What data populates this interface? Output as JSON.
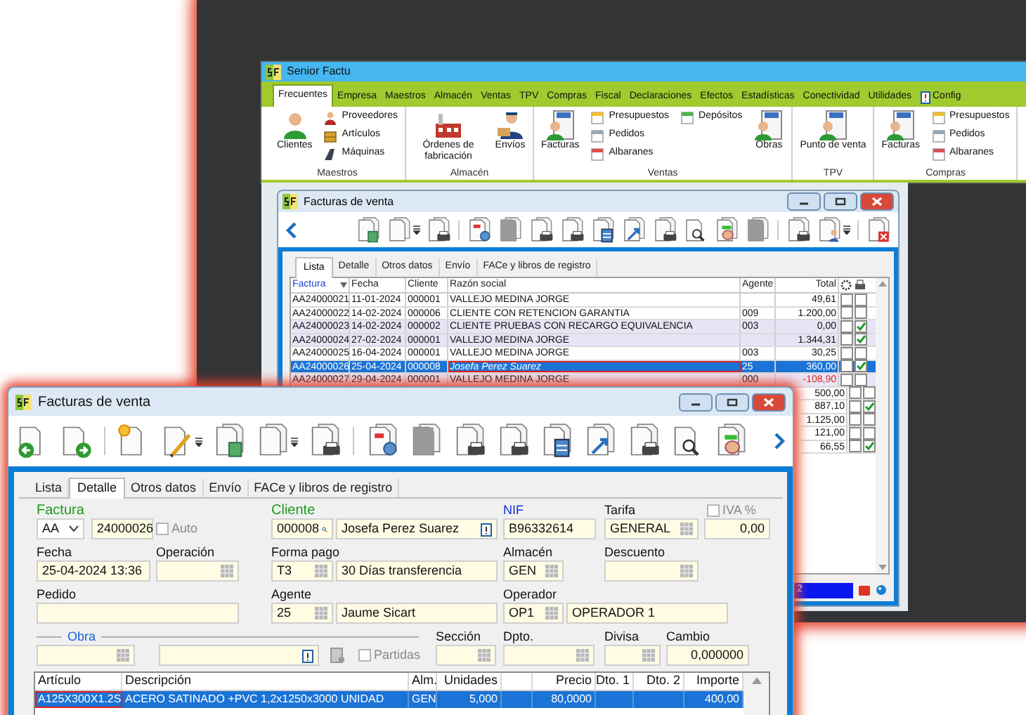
{
  "app": {
    "title": "Senior Factu",
    "tabs": [
      {
        "label": "Frecuentes",
        "selected": true
      },
      {
        "label": "Empresa",
        "selected": false
      },
      {
        "label": "Maestros",
        "selected": false
      },
      {
        "label": "Almacén",
        "selected": false
      },
      {
        "label": "Ventas",
        "selected": false
      },
      {
        "label": "TPV",
        "selected": false
      },
      {
        "label": "Compras",
        "selected": false
      },
      {
        "label": "Fiscal",
        "selected": false
      },
      {
        "label": "Declaraciones",
        "selected": false
      },
      {
        "label": "Efectos",
        "selected": false
      },
      {
        "label": "Estadísticas",
        "selected": false
      },
      {
        "label": "Conectividad",
        "selected": false
      },
      {
        "label": "Utilidades",
        "selected": false
      },
      {
        "label": "Config",
        "selected": false
      }
    ],
    "groups": [
      {
        "label": "Maestros",
        "items": [
          {
            "kind": "large",
            "label": "Clientes"
          },
          {
            "kind": "small",
            "label": "Proveedores"
          },
          {
            "kind": "small",
            "label": "Artículos"
          },
          {
            "kind": "small",
            "label": "Máquinas"
          }
        ]
      },
      {
        "label": "Almacén",
        "items": [
          {
            "kind": "large",
            "label": "Órdenes de fabricación"
          },
          {
            "kind": "large",
            "label": "Envíos"
          }
        ]
      },
      {
        "label": "Ventas",
        "items": [
          {
            "kind": "large",
            "label": "Facturas"
          },
          {
            "kind": "small",
            "label": "Presupuestos"
          },
          {
            "kind": "small",
            "label": "Pedidos"
          },
          {
            "kind": "small",
            "label": "Albaranes"
          },
          {
            "kind": "small",
            "label": "Depósitos"
          },
          {
            "kind": "large",
            "label": "Obras"
          }
        ]
      },
      {
        "label": "TPV",
        "items": [
          {
            "kind": "large",
            "label": "Punto de venta"
          }
        ]
      },
      {
        "label": "Compras",
        "items": [
          {
            "kind": "large",
            "label": "Facturas"
          },
          {
            "kind": "small",
            "label": "Presupuestos"
          },
          {
            "kind": "small",
            "label": "Pedidos"
          },
          {
            "kind": "small",
            "label": "Albaranes"
          }
        ]
      }
    ]
  },
  "list_window": {
    "title": "Facturas de venta",
    "tabs": [
      {
        "label": "Lista",
        "selected": true
      },
      {
        "label": "Detalle",
        "selected": false
      },
      {
        "label": "Otros datos",
        "selected": false
      },
      {
        "label": "Envío",
        "selected": false
      },
      {
        "label": "FACe y libros de registro",
        "selected": false
      }
    ],
    "columns": [
      "Factura",
      "Fecha",
      "Cliente",
      "Razón social",
      "Agente",
      "Total"
    ],
    "rows": [
      {
        "factura": "AA24000021",
        "fecha": "11-01-2024",
        "cliente": "000001",
        "razon_social": "VALLEJO MEDINA JORGE",
        "agente": "",
        "total": "49,61",
        "negative": false,
        "shaded": false,
        "selected": false,
        "check_1": false,
        "check_2": false
      },
      {
        "factura": "AA24000022",
        "fecha": "14-02-2024",
        "cliente": "000006",
        "razon_social": "CLIENTE CON RETENCION GARANTIA",
        "agente": "009",
        "total": "1.200,00",
        "negative": false,
        "shaded": false,
        "selected": false,
        "check_1": false,
        "check_2": false
      },
      {
        "factura": "AA24000023",
        "fecha": "14-02-2024",
        "cliente": "000002",
        "razon_social": "CLIENTE PRUEBAS CON RECARGO EQUIVALENCIA",
        "agente": "003",
        "total": "0,00",
        "negative": false,
        "shaded": true,
        "selected": false,
        "check_1": false,
        "check_2": true
      },
      {
        "factura": "AA24000024",
        "fecha": "27-02-2024",
        "cliente": "000001",
        "razon_social": "VALLEJO MEDINA JORGE",
        "agente": "",
        "total": "1.344,31",
        "negative": false,
        "shaded": true,
        "selected": false,
        "check_1": false,
        "check_2": true
      },
      {
        "factura": "AA24000025",
        "fecha": "16-04-2024",
        "cliente": "000001",
        "razon_social": "VALLEJO MEDINA JORGE",
        "agente": "003",
        "total": "30,25",
        "negative": false,
        "shaded": false,
        "selected": false,
        "check_1": false,
        "check_2": false
      },
      {
        "factura": "AA24000026",
        "fecha": "25-04-2024",
        "cliente": "000008",
        "razon_social": "Josefa Perez Suarez",
        "agente": "25",
        "total": "360,00",
        "negative": false,
        "selected": true,
        "check_1": false,
        "check_2": true
      },
      {
        "factura": "AA24000027",
        "fecha": "29-04-2024",
        "cliente": "000001",
        "razon_social": "VALLEJO MEDINA JORGE",
        "agente": "000",
        "total": "-108,90",
        "negative": true,
        "shaded": true,
        "selected": false,
        "check_1": false,
        "check_2": false
      },
      {
        "total": "500,00",
        "negative": false,
        "shaded": false,
        "selected": false,
        "check_1": false,
        "check_2": false
      },
      {
        "total": "887,10",
        "negative": false,
        "shaded": false,
        "selected": false,
        "check_1": false,
        "check_2": true
      },
      {
        "total": "1.125,00",
        "negative": false,
        "shaded": false,
        "selected": false,
        "check_1": false,
        "check_2": false
      },
      {
        "total": "121,00",
        "negative": false,
        "shaded": false,
        "selected": false,
        "check_1": false,
        "check_2": false
      },
      {
        "total": "66,55",
        "negative": false,
        "shaded": false,
        "selected": false,
        "check_1": false,
        "check_2": true
      }
    ],
    "status_field": "2"
  },
  "detail_window": {
    "title": "Facturas de venta",
    "tabs": [
      {
        "label": "Lista",
        "selected": false
      },
      {
        "label": "Detalle",
        "selected": true
      },
      {
        "label": "Otros datos",
        "selected": false
      },
      {
        "label": "Envío",
        "selected": false
      },
      {
        "label": "FACe y libros de registro",
        "selected": false
      }
    ],
    "form": {
      "factura": {
        "label": "Factura",
        "serie": "AA",
        "number": "24000026"
      },
      "auto": {
        "label": "Auto",
        "checked": false
      },
      "cliente": {
        "label": "Cliente",
        "code": "000008",
        "name": "Josefa Perez Suarez"
      },
      "nif": {
        "label": "NIF",
        "value": "B96332614"
      },
      "tarifa": {
        "label": "Tarifa",
        "value": "GENERAL"
      },
      "iva": {
        "label": "IVA %",
        "checked": false,
        "value": "0,00"
      },
      "fecha": {
        "label": "Fecha",
        "value": "25-04-2024 13:36"
      },
      "operacion": {
        "label": "Operación"
      },
      "forma_pago": {
        "label": "Forma pago",
        "code": "T3",
        "name": "30 Días transferencia"
      },
      "almacen": {
        "label": "Almacén",
        "value": "GEN"
      },
      "descuento": {
        "label": "Descuento"
      },
      "pedido": {
        "label": "Pedido"
      },
      "agente": {
        "label": "Agente",
        "code": "25",
        "name": "Jaume Sicart"
      },
      "operador": {
        "label": "Operador",
        "code": "OP1",
        "name": "OPERADOR 1"
      },
      "obra": {
        "label": "Obra"
      },
      "partidas": {
        "label": "Partidas",
        "checked": false
      },
      "seccion": {
        "label": "Sección"
      },
      "dpto": {
        "label": "Dpto."
      },
      "divisa": {
        "label": "Divisa"
      },
      "cambio": {
        "label": "Cambio",
        "value": "0,000000"
      }
    },
    "lines": {
      "columns": [
        "Artículo",
        "Descripción",
        "Alm.",
        "Unidades",
        "",
        "Precio",
        "Dto. 1",
        "Dto. 2",
        "Importe"
      ],
      "rows": [
        {
          "selected": true,
          "cells": [
            "A125X300X1.2S",
            "ACERO SATINADO +PVC 1,2x1250x3000 UNIDAD",
            "GEN",
            "5,000",
            "",
            "80,0000",
            "",
            "",
            "400,00"
          ]
        }
      ]
    }
  }
}
